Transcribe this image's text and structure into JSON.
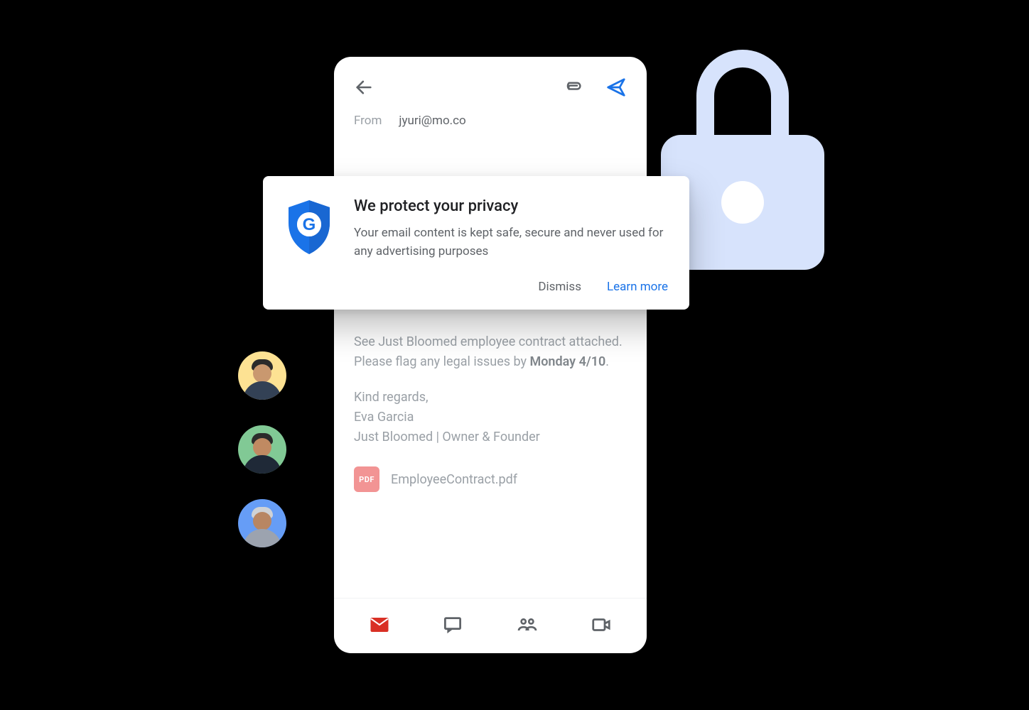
{
  "compose": {
    "from_label": "From",
    "from_value": "jyuri@mo.co",
    "body_intro": "See Just Bloomed employee contract attached. Please flag any legal issues by ",
    "body_deadline": "Monday 4/10",
    "body_period": ".",
    "sig_line1": "Kind regards,",
    "sig_line2": "Eva Garcia",
    "sig_line3": "Just Bloomed | Owner & Founder",
    "attachment": {
      "badge": "PDF",
      "name": "EmployeeContract.pdf"
    }
  },
  "privacy": {
    "title": "We protect your privacy",
    "desc": "Your email content is kept safe, secure and never used for any advertising purposes",
    "dismiss": "Dismiss",
    "learn_more": "Learn more"
  },
  "tabs": {
    "mail": "mail-icon",
    "chat": "chat-icon",
    "spaces": "spaces-icon",
    "meet": "meet-icon"
  },
  "icons": {
    "back": "back-icon",
    "attach": "attachment-icon",
    "send": "send-icon",
    "shield": "google-shield-icon",
    "lock": "lock-icon"
  },
  "avatars": {
    "a1": "avatar-person-1",
    "a2": "avatar-person-2",
    "a3": "avatar-person-3"
  },
  "colors": {
    "accent_blue": "#1a73e8",
    "text_secondary": "#5f6368",
    "lock_fill": "#d7e3fc",
    "danger_red": "#d93025"
  }
}
